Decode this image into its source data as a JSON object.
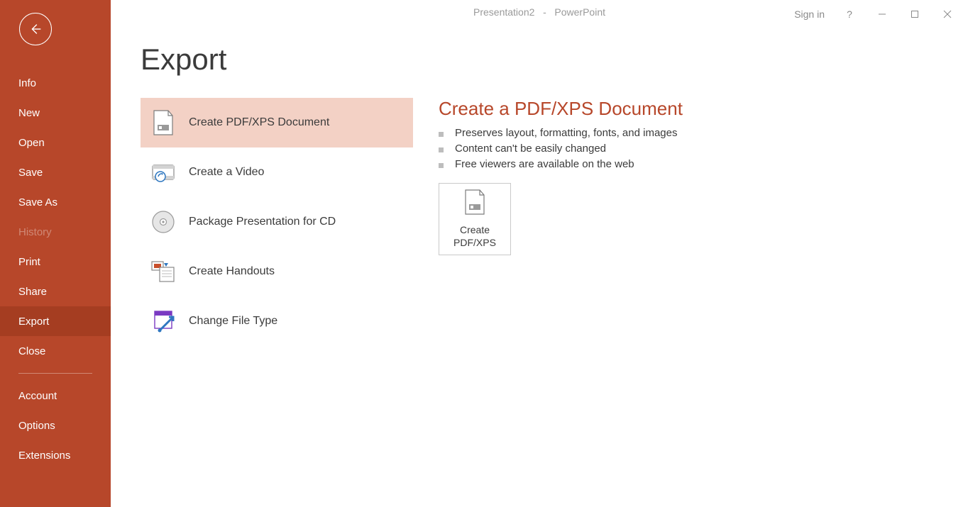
{
  "titlebar": {
    "doc_name": "Presentation2",
    "separator": "-",
    "app_name": "PowerPoint",
    "sign_in": "Sign in",
    "help": "?"
  },
  "sidebar": {
    "items": [
      {
        "label": "Info",
        "state": "normal"
      },
      {
        "label": "New",
        "state": "normal"
      },
      {
        "label": "Open",
        "state": "normal"
      },
      {
        "label": "Save",
        "state": "normal"
      },
      {
        "label": "Save As",
        "state": "normal"
      },
      {
        "label": "History",
        "state": "disabled"
      },
      {
        "label": "Print",
        "state": "normal"
      },
      {
        "label": "Share",
        "state": "normal"
      },
      {
        "label": "Export",
        "state": "active"
      },
      {
        "label": "Close",
        "state": "normal"
      }
    ],
    "footer_items": [
      {
        "label": "Account"
      },
      {
        "label": "Options"
      },
      {
        "label": "Extensions"
      }
    ]
  },
  "page": {
    "title": "Export",
    "options": [
      {
        "label": "Create PDF/XPS Document",
        "selected": true,
        "icon": "pdf-document-icon"
      },
      {
        "label": "Create a Video",
        "selected": false,
        "icon": "video-icon"
      },
      {
        "label": "Package Presentation for CD",
        "selected": false,
        "icon": "cd-icon"
      },
      {
        "label": "Create Handouts",
        "selected": false,
        "icon": "handouts-icon"
      },
      {
        "label": "Change File Type",
        "selected": false,
        "icon": "change-filetype-icon"
      }
    ],
    "detail": {
      "title": "Create a PDF/XPS Document",
      "bullets": [
        "Preserves layout, formatting, fonts, and images",
        "Content can't be easily changed",
        "Free viewers are available on the web"
      ],
      "action_line1": "Create",
      "action_line2": "PDF/XPS"
    }
  }
}
